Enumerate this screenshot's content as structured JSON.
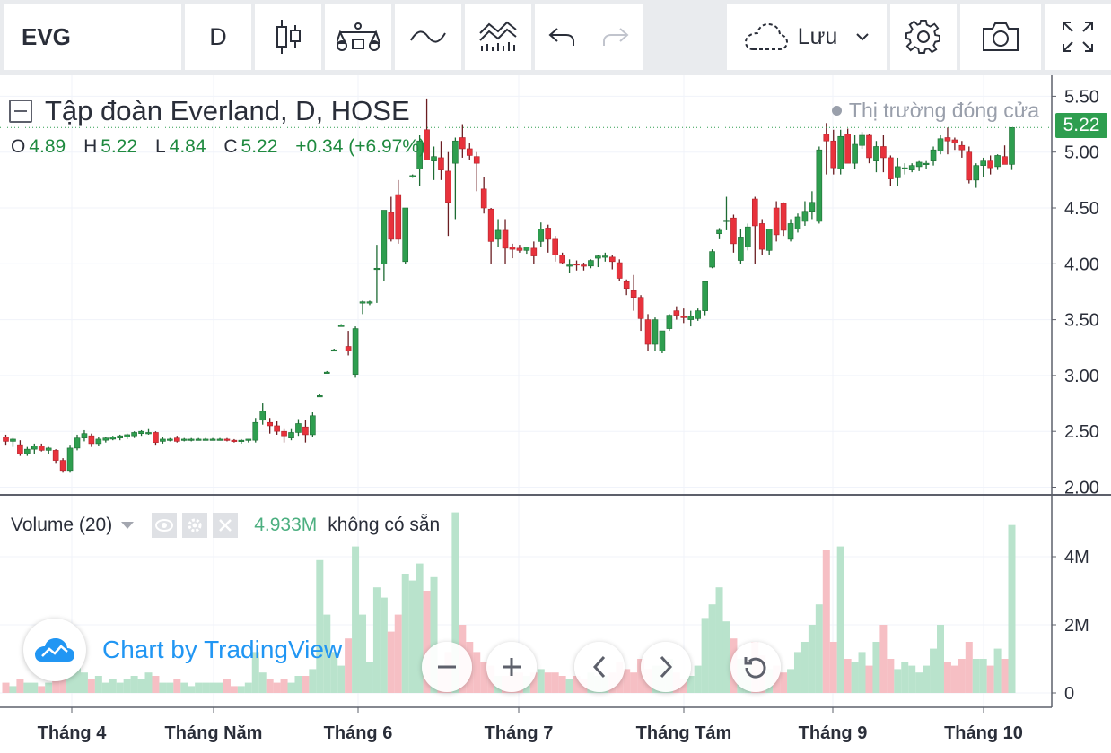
{
  "toolbar": {
    "symbol": "EVG",
    "interval": "D",
    "save_label": "Lưu"
  },
  "legend": {
    "title": "Tập đoàn Everland, D, HOSE",
    "ohlc": [
      {
        "key": "O",
        "value": "4.89"
      },
      {
        "key": "H",
        "value": "5.22"
      },
      {
        "key": "L",
        "value": "4.84"
      },
      {
        "key": "C",
        "value": "5.22"
      }
    ],
    "change": "+0.34 (+6.97%)",
    "market_status": "Thị trường đóng cửa"
  },
  "volume_legend": {
    "title": "Volume (20)",
    "value": "4.933M",
    "status": "không có sẵn"
  },
  "last_price": "5.22",
  "branding": "Chart by TradingView",
  "colors": {
    "up": "#2e9e4f",
    "down": "#e8323c",
    "vol_up": "#b9e3cc",
    "vol_down": "#f6bfc4"
  },
  "chart_data": {
    "type": "candlestick",
    "price_axis": {
      "ticks": [
        "5.50",
        "5.00",
        "4.50",
        "4.00",
        "3.50",
        "3.00",
        "2.50",
        "2.00"
      ],
      "range": [
        2.0,
        5.5
      ]
    },
    "volume_axis": {
      "ticks": [
        "4M",
        "2M",
        "0"
      ],
      "range": [
        0,
        5.2
      ]
    },
    "time_axis": {
      "labels": [
        "Tháng 4",
        "Tháng Năm",
        "Tháng 6",
        "Tháng 7",
        "Tháng Tám",
        "Tháng 9",
        "Tháng 10"
      ]
    },
    "candles": [
      [
        2.45,
        2.47,
        2.38,
        2.41,
        0.3
      ],
      [
        2.41,
        2.44,
        2.36,
        2.43,
        0.2
      ],
      [
        2.38,
        2.42,
        2.28,
        2.3,
        0.4
      ],
      [
        2.3,
        2.36,
        2.28,
        2.34,
        0.3
      ],
      [
        2.34,
        2.39,
        2.3,
        2.37,
        0.3
      ],
      [
        2.37,
        2.39,
        2.32,
        2.33,
        0.2
      ],
      [
        2.33,
        2.36,
        2.3,
        2.35,
        0.3
      ],
      [
        2.33,
        2.34,
        2.21,
        2.24,
        0.6
      ],
      [
        2.24,
        2.26,
        2.13,
        2.15,
        0.5
      ],
      [
        2.15,
        2.38,
        2.13,
        2.35,
        1.4
      ],
      [
        2.35,
        2.47,
        2.33,
        2.44,
        1.0
      ],
      [
        2.44,
        2.51,
        2.41,
        2.48,
        0.6
      ],
      [
        2.46,
        2.48,
        2.36,
        2.39,
        0.4
      ],
      [
        2.39,
        2.45,
        2.37,
        2.43,
        0.5
      ],
      [
        2.42,
        2.45,
        2.4,
        2.44,
        0.3
      ],
      [
        2.43,
        2.46,
        2.42,
        2.45,
        0.4
      ],
      [
        2.44,
        2.47,
        2.42,
        2.46,
        0.3
      ],
      [
        2.45,
        2.48,
        2.43,
        2.47,
        0.4
      ],
      [
        2.46,
        2.5,
        2.44,
        2.49,
        0.5
      ],
      [
        2.48,
        2.51,
        2.46,
        2.5,
        0.4
      ],
      [
        2.49,
        2.52,
        2.47,
        2.49,
        0.6
      ],
      [
        2.49,
        2.5,
        2.38,
        2.4,
        0.5
      ],
      [
        2.41,
        2.45,
        2.39,
        2.43,
        0.3
      ],
      [
        2.43,
        2.44,
        2.41,
        2.43,
        0.3
      ],
      [
        2.44,
        2.46,
        2.4,
        2.41,
        0.4
      ],
      [
        2.42,
        2.44,
        2.41,
        2.43,
        0.3
      ],
      [
        2.43,
        2.44,
        2.41,
        2.43,
        0.2
      ],
      [
        2.43,
        2.44,
        2.42,
        2.43,
        0.3
      ],
      [
        2.43,
        2.44,
        2.42,
        2.43,
        0.3
      ],
      [
        2.43,
        2.44,
        2.42,
        2.43,
        0.3
      ],
      [
        2.43,
        2.44,
        2.42,
        2.43,
        0.3
      ],
      [
        2.43,
        2.44,
        2.41,
        2.42,
        0.4
      ],
      [
        2.42,
        2.43,
        2.4,
        2.41,
        0.2
      ],
      [
        2.41,
        2.43,
        2.39,
        2.42,
        0.2
      ],
      [
        2.42,
        2.43,
        2.4,
        2.43,
        0.3
      ],
      [
        2.42,
        2.62,
        2.4,
        2.58,
        1.2
      ],
      [
        2.6,
        2.75,
        2.56,
        2.68,
        0.6
      ],
      [
        2.58,
        2.62,
        2.48,
        2.55,
        0.4
      ],
      [
        2.55,
        2.59,
        2.47,
        2.5,
        0.3
      ],
      [
        2.5,
        2.52,
        2.4,
        2.46,
        0.4
      ],
      [
        2.44,
        2.52,
        2.42,
        2.49,
        0.3
      ],
      [
        2.49,
        2.61,
        2.46,
        2.57,
        0.5
      ],
      [
        2.54,
        2.6,
        2.4,
        2.47,
        0.5
      ],
      [
        2.47,
        2.67,
        2.45,
        2.64,
        0.7
      ],
      [
        2.82,
        2.83,
        2.81,
        2.82,
        3.9
      ],
      [
        3.03,
        3.04,
        3.02,
        3.03,
        2.3
      ],
      [
        3.23,
        3.24,
        3.22,
        3.23,
        1.2
      ],
      [
        3.45,
        3.46,
        3.44,
        3.45,
        0.8
      ],
      [
        3.26,
        3.4,
        3.18,
        3.22,
        1.6
      ],
      [
        3.01,
        3.44,
        2.98,
        3.42,
        4.3
      ],
      [
        3.65,
        3.67,
        3.55,
        3.66,
        2.3
      ],
      [
        3.66,
        3.67,
        3.63,
        3.66,
        0.9
      ],
      [
        3.95,
        4.17,
        3.65,
        3.96,
        3.1
      ],
      [
        4.0,
        4.47,
        3.85,
        4.48,
        2.8
      ],
      [
        4.46,
        4.6,
        4.2,
        4.22,
        1.8
      ],
      [
        4.62,
        4.75,
        4.18,
        4.22,
        2.3
      ],
      [
        4.02,
        4.49,
        4.0,
        4.5,
        3.5
      ],
      [
        4.78,
        4.8,
        4.77,
        4.79,
        3.3
      ],
      [
        4.85,
        5.15,
        4.7,
        5.1,
        3.8
      ],
      [
        5.2,
        5.48,
        4.95,
        4.93,
        3.0
      ],
      [
        4.92,
        5.05,
        4.75,
        4.96,
        3.4
      ],
      [
        4.95,
        5.1,
        4.75,
        4.84,
        0.8
      ],
      [
        4.83,
        5.0,
        4.25,
        4.55,
        1.2
      ],
      [
        4.9,
        5.13,
        4.4,
        5.1,
        5.3
      ],
      [
        5.13,
        5.25,
        4.95,
        5.03,
        2.0
      ],
      [
        5.03,
        5.08,
        4.93,
        4.97,
        1.5
      ],
      [
        4.96,
        5.0,
        4.65,
        4.9,
        1.2
      ],
      [
        4.67,
        4.78,
        4.45,
        4.5,
        0.9
      ],
      [
        4.49,
        4.5,
        4.0,
        4.2,
        0.8
      ],
      [
        4.22,
        4.4,
        4.15,
        4.3,
        0.5
      ],
      [
        4.3,
        4.4,
        4.0,
        4.14,
        0.5
      ],
      [
        4.15,
        4.18,
        4.05,
        4.13,
        0.6
      ],
      [
        4.14,
        4.17,
        4.1,
        4.12,
        0.6
      ],
      [
        4.12,
        4.15,
        4.09,
        4.15,
        0.5
      ],
      [
        4.14,
        4.2,
        4.0,
        4.07,
        0.6
      ],
      [
        4.2,
        4.37,
        4.15,
        4.31,
        0.7
      ],
      [
        4.32,
        4.35,
        4.1,
        4.22,
        0.6
      ],
      [
        4.22,
        4.25,
        4.02,
        4.08,
        0.6
      ],
      [
        4.08,
        4.1,
        4.0,
        4.01,
        0.5
      ],
      [
        3.99,
        4.04,
        3.92,
        3.99,
        0.4
      ],
      [
        4.0,
        4.03,
        3.94,
        3.99,
        0.5
      ],
      [
        3.99,
        4.01,
        3.94,
        3.98,
        0.4
      ],
      [
        3.98,
        4.04,
        3.96,
        4.03,
        0.6
      ],
      [
        4.05,
        4.08,
        3.97,
        4.07,
        0.5
      ],
      [
        4.07,
        4.1,
        4.02,
        4.07,
        0.5
      ],
      [
        4.06,
        4.08,
        3.95,
        4.02,
        0.6
      ],
      [
        4.01,
        4.04,
        3.85,
        3.87,
        0.9
      ],
      [
        3.84,
        3.86,
        3.72,
        3.78,
        0.7
      ],
      [
        3.76,
        3.9,
        3.58,
        3.7,
        0.6
      ],
      [
        3.7,
        3.72,
        3.4,
        3.51,
        1.0
      ],
      [
        3.5,
        3.55,
        3.22,
        3.28,
        0.7
      ],
      [
        3.28,
        3.52,
        3.22,
        3.5,
        0.8
      ],
      [
        3.22,
        3.4,
        3.2,
        3.4,
        0.8
      ],
      [
        3.42,
        3.55,
        3.4,
        3.54,
        1.0
      ],
      [
        3.58,
        3.62,
        3.5,
        3.54,
        0.6
      ],
      [
        3.53,
        3.6,
        3.47,
        3.52,
        0.4
      ],
      [
        3.5,
        3.58,
        3.44,
        3.53,
        0.5
      ],
      [
        3.51,
        3.6,
        3.49,
        3.58,
        0.8
      ],
      [
        3.58,
        3.85,
        3.54,
        3.84,
        2.2
      ],
      [
        3.97,
        4.13,
        3.96,
        4.11,
        2.6
      ],
      [
        4.27,
        4.32,
        4.22,
        4.3,
        3.1
      ],
      [
        4.38,
        4.6,
        4.3,
        4.39,
        2.1
      ],
      [
        4.41,
        4.44,
        4.1,
        4.18,
        1.6
      ],
      [
        4.03,
        4.31,
        4.0,
        4.24,
        1.0
      ],
      [
        4.15,
        4.36,
        4.12,
        4.33,
        0.9
      ],
      [
        4.58,
        4.6,
        4.0,
        4.34,
        1.5
      ],
      [
        4.36,
        4.4,
        4.08,
        4.13,
        1.1
      ],
      [
        4.12,
        4.3,
        4.08,
        4.31,
        0.7
      ],
      [
        4.5,
        4.56,
        4.2,
        4.26,
        0.8
      ],
      [
        4.54,
        4.55,
        4.25,
        4.3,
        0.6
      ],
      [
        4.22,
        4.4,
        4.2,
        4.36,
        0.7
      ],
      [
        4.31,
        4.45,
        4.28,
        4.42,
        1.2
      ],
      [
        4.38,
        4.56,
        4.34,
        4.47,
        1.5
      ],
      [
        4.47,
        4.65,
        4.4,
        4.55,
        2.0
      ],
      [
        4.38,
        5.05,
        4.36,
        5.02,
        2.6
      ],
      [
        5.16,
        5.26,
        4.8,
        5.1,
        4.2
      ],
      [
        5.1,
        5.2,
        4.8,
        4.86,
        1.5
      ],
      [
        4.85,
        5.2,
        4.8,
        5.14,
        4.3
      ],
      [
        5.16,
        5.21,
        4.95,
        4.9,
        1.0
      ],
      [
        4.9,
        5.15,
        4.85,
        5.07,
        0.9
      ],
      [
        5.06,
        5.18,
        5.03,
        5.15,
        1.2
      ],
      [
        5.15,
        5.16,
        4.9,
        4.95,
        0.8
      ],
      [
        4.92,
        5.1,
        4.82,
        5.05,
        1.5
      ],
      [
        5.05,
        5.15,
        4.82,
        4.95,
        2.0
      ],
      [
        4.95,
        4.97,
        4.7,
        4.76,
        1.0
      ],
      [
        4.77,
        4.95,
        4.7,
        4.87,
        0.7
      ],
      [
        4.85,
        4.9,
        4.8,
        4.86,
        0.9
      ],
      [
        4.84,
        4.9,
        4.82,
        4.88,
        0.8
      ],
      [
        4.87,
        4.92,
        4.83,
        4.91,
        0.6
      ],
      [
        4.9,
        4.92,
        4.85,
        4.9,
        0.8
      ],
      [
        4.92,
        5.05,
        4.88,
        5.02,
        1.3
      ],
      [
        5.01,
        5.15,
        4.98,
        5.12,
        2.0
      ],
      [
        5.13,
        5.22,
        4.98,
        5.1,
        0.9
      ],
      [
        5.11,
        5.13,
        5.02,
        5.08,
        0.8
      ],
      [
        5.06,
        5.1,
        4.95,
        5.02,
        1.0
      ],
      [
        5.0,
        5.05,
        4.72,
        4.75,
        1.5
      ],
      [
        4.75,
        4.9,
        4.68,
        4.88,
        1.0
      ],
      [
        4.88,
        4.95,
        4.78,
        4.92,
        1.0
      ],
      [
        4.92,
        4.97,
        4.8,
        4.86,
        0.8
      ],
      [
        4.87,
        4.98,
        4.84,
        4.97,
        1.3
      ],
      [
        4.96,
        5.06,
        4.92,
        4.89,
        1.0
      ],
      [
        4.89,
        5.22,
        4.84,
        5.22,
        4.93
      ]
    ]
  }
}
